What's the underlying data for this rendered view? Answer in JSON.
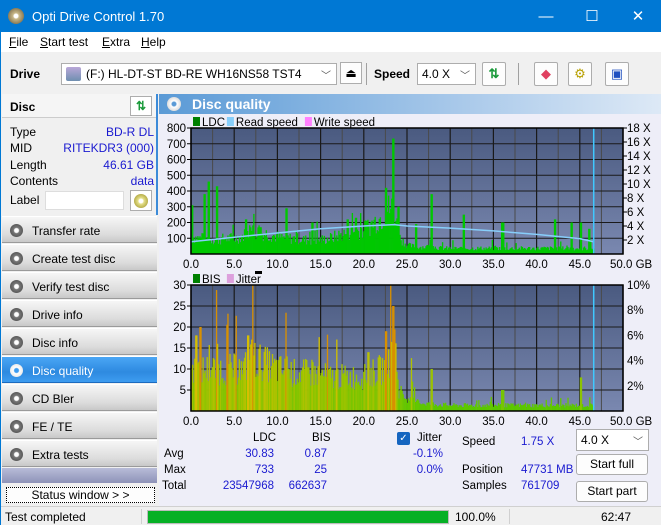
{
  "window": {
    "title": "Opti Drive Control 1.70",
    "controls": {
      "minimize": "—",
      "maximize": "☐",
      "close": "✕"
    }
  },
  "menu": [
    {
      "label": "File",
      "accel": "F",
      "rest": "ile"
    },
    {
      "label": "Start test",
      "accel": "S",
      "rest": "tart test"
    },
    {
      "label": "Extra",
      "accel": "E",
      "rest": "xtra"
    },
    {
      "label": "Help",
      "accel": "H",
      "rest": "elp"
    }
  ],
  "toolbar": {
    "drive_label": "Drive",
    "drive_value": "(F:)  HL-DT-ST BD-RE  WH16NS58 TST4",
    "speed_label": "Speed",
    "speed_value": "4.0 X",
    "icons": [
      "eject-icon",
      "refresh-icon",
      "erase-icon",
      "settings-icon",
      "save-icon"
    ]
  },
  "disc": {
    "title": "Disc",
    "rows": [
      {
        "key": "Type",
        "value": "BD-R DL"
      },
      {
        "key": "MID",
        "value": "RITEKDR3 (000)"
      },
      {
        "key": "Length",
        "value": "46.61 GB"
      },
      {
        "key": "Contents",
        "value": "data"
      }
    ],
    "label_key": "Label",
    "label_value": ""
  },
  "nav": [
    {
      "label": "Transfer rate",
      "active": false
    },
    {
      "label": "Create test disc",
      "active": false
    },
    {
      "label": "Verify test disc",
      "active": false
    },
    {
      "label": "Drive info",
      "active": false
    },
    {
      "label": "Disc info",
      "active": false
    },
    {
      "label": "Disc quality",
      "active": true
    },
    {
      "label": "CD Bler",
      "active": false
    },
    {
      "label": "FE / TE",
      "active": false
    },
    {
      "label": "Extra tests",
      "active": false
    }
  ],
  "status_window_button": "Status window > >",
  "panel": {
    "title": "Disc quality"
  },
  "chart_data": [
    {
      "type": "bar",
      "title": "LDC / Read speed",
      "legend": [
        {
          "name": "LDC",
          "color": "#008000"
        },
        {
          "name": "Read speed",
          "color": "#87cefa"
        },
        {
          "name": "Write speed",
          "color": "#ff80ff"
        }
      ],
      "legend_placement": "top-left",
      "xlabel": "GB",
      "x_ticks": [
        "0.0",
        "5.0",
        "10.0",
        "15.0",
        "20.0",
        "25.0",
        "30.0",
        "35.0",
        "40.0",
        "45.0",
        "50.0 GB"
      ],
      "xlim": [
        0,
        50
      ],
      "ylim_left": [
        0,
        800
      ],
      "y_ticks_left": [
        "800",
        "700",
        "600",
        "500",
        "400",
        "300",
        "200",
        "100"
      ],
      "ylim_right": [
        0,
        18
      ],
      "y_ticks_right": [
        "18 X",
        "16 X",
        "14 X",
        "12 X",
        "10 X",
        "8 X",
        "6 X",
        "4 X",
        "2 X"
      ],
      "grid": true,
      "marker_x": 46.61,
      "ldc_profile": {
        "x": [
          0,
          1,
          2,
          3,
          4,
          5,
          6,
          7,
          8,
          9,
          10,
          11,
          12,
          13,
          14,
          15,
          16,
          17,
          18,
          19,
          20,
          21,
          22,
          23,
          23.5,
          24,
          25,
          26,
          27,
          28,
          29,
          30,
          31,
          32,
          33,
          34,
          35,
          36,
          37,
          38,
          39,
          40,
          41,
          42,
          43,
          44,
          45,
          46,
          46.6
        ],
        "base": [
          120,
          110,
          105,
          100,
          110,
          110,
          130,
          160,
          150,
          140,
          120,
          110,
          110,
          100,
          100,
          100,
          110,
          130,
          150,
          160,
          170,
          220,
          260,
          330,
          300,
          120,
          60,
          50,
          50,
          50,
          40,
          40,
          40,
          40,
          40,
          40,
          40,
          40,
          40,
          40,
          40,
          40,
          40,
          40,
          40,
          40,
          40,
          40,
          40
        ],
        "peaks": [
          [
            0.1,
            310
          ],
          [
            1.5,
            380
          ],
          [
            2.0,
            460
          ],
          [
            3.0,
            430
          ],
          [
            6.3,
            220
          ],
          [
            8.0,
            170
          ],
          [
            11.0,
            290
          ],
          [
            14.0,
            200
          ],
          [
            18.0,
            220
          ],
          [
            19.0,
            230
          ],
          [
            22.5,
            420
          ],
          [
            23.3,
            733
          ],
          [
            24.0,
            300
          ],
          [
            26.0,
            190
          ],
          [
            27.8,
            380
          ],
          [
            31.5,
            250
          ],
          [
            36.0,
            200
          ],
          [
            42.0,
            220
          ],
          [
            44.0,
            200
          ],
          [
            45.0,
            200
          ],
          [
            46.0,
            160
          ]
        ]
      },
      "read_speed": {
        "x": [
          0,
          5,
          10,
          15,
          20,
          23.5,
          25,
          30,
          35,
          40,
          45,
          46.6
        ],
        "values": [
          1.75,
          2.4,
          3.0,
          3.6,
          4.0,
          4.2,
          4.0,
          3.7,
          3.3,
          2.8,
          2.2,
          1.75
        ]
      }
    },
    {
      "type": "bar",
      "title": "BIS / Jitter",
      "legend": [
        {
          "name": "BIS",
          "color": "#008000"
        },
        {
          "name": "Jitter",
          "color": "#dda0dd"
        }
      ],
      "legend_placement": "top-left",
      "xlabel": "GB",
      "x_ticks": [
        "0.0",
        "5.0",
        "10.0",
        "15.0",
        "20.0",
        "25.0",
        "30.0",
        "35.0",
        "40.0",
        "45.0",
        "50.0 GB"
      ],
      "xlim": [
        0,
        50
      ],
      "ylim_left": [
        0,
        30
      ],
      "y_ticks_left": [
        "30",
        "25",
        "20",
        "15",
        "10",
        "5"
      ],
      "ylim_right": [
        0,
        10
      ],
      "y_ticks_right": [
        "10%",
        "8%",
        "6%",
        "4%",
        "2%"
      ],
      "grid": true,
      "marker_x": 46.61,
      "bis_profile": {
        "x": [
          0,
          2,
          4,
          6,
          7,
          8,
          10,
          12,
          14,
          16,
          18,
          20,
          22,
          23,
          23.4,
          24,
          25,
          27,
          30,
          35,
          40,
          45,
          46.6
        ],
        "base": [
          11,
          11,
          11,
          11,
          14,
          13,
          11,
          10,
          10,
          9,
          9,
          9,
          11,
          14,
          22,
          5,
          3,
          2,
          1.5,
          1.5,
          1.5,
          1.5,
          1.5
        ],
        "peaks": [
          [
            0.5,
            18
          ],
          [
            1.0,
            20
          ],
          [
            3.0,
            16
          ],
          [
            6.5,
            18
          ],
          [
            7.0,
            17
          ],
          [
            11.0,
            13
          ],
          [
            20.5,
            14
          ],
          [
            22.5,
            19
          ],
          [
            23.3,
            25
          ],
          [
            25.5,
            7
          ],
          [
            27.8,
            10
          ],
          [
            36.0,
            5
          ],
          [
            45.0,
            8
          ]
        ]
      }
    }
  ],
  "stats": {
    "col_ldc": "LDC",
    "col_bis": "BIS",
    "jitter_label": "Jitter",
    "jitter_checked": true,
    "rows": [
      {
        "label": "Avg",
        "ldc": "30.83",
        "bis": "0.87",
        "jitter": "-0.1%"
      },
      {
        "label": "Max",
        "ldc": "733",
        "bis": "25",
        "jitter": "0.0%"
      },
      {
        "label": "Total",
        "ldc": "23547968",
        "bis": "662637",
        "jitter": ""
      }
    ],
    "speed_label": "Speed",
    "speed_value": "1.75 X",
    "position_label": "Position",
    "position_value": "47731 MB",
    "samples_label": "Samples",
    "samples_value": "761709",
    "speed_select": "4.0 X",
    "start_full": "Start full",
    "start_part": "Start part"
  },
  "statusbar": {
    "text": "Test completed",
    "progress_percent": 100.0,
    "progress_label": "100.0%",
    "elapsed": "62:47"
  }
}
